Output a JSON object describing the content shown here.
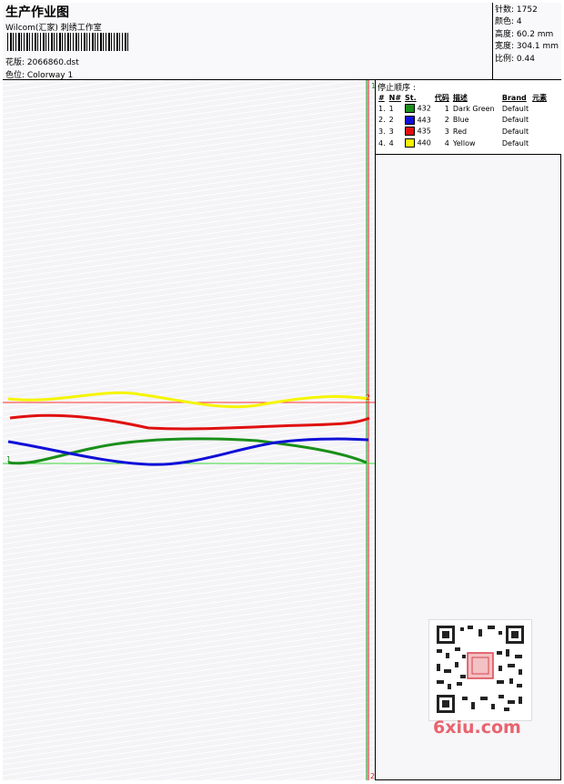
{
  "header": {
    "title": "生产作业图",
    "subtitle": "Wilcom(汇家) 刺绣工作室",
    "design_label": "花版: 2066860.dst",
    "colorway_label": "色位: Colorway 1"
  },
  "stats": {
    "stitches": "针数: 1752",
    "colors": "颜色: 4",
    "height": "高度: 60.2 mm",
    "width": "宽度: 304.1 mm",
    "scale": "比例: 0.44"
  },
  "stop_sequence": {
    "heading": "停止顺序 :",
    "columns": [
      "#",
      "N#",
      "St.",
      "代码",
      "描述",
      "Brand",
      "元素"
    ],
    "rows": [
      {
        "num": "1.",
        "n": "1",
        "st": "432",
        "code": "1",
        "desc": "Dark Green",
        "brand": "Default",
        "color": "#1a8f1a"
      },
      {
        "num": "2.",
        "n": "2",
        "st": "443",
        "code": "2",
        "desc": "Blue",
        "brand": "Default",
        "color": "#1010d8"
      },
      {
        "num": "3.",
        "n": "3",
        "st": "435",
        "code": "3",
        "desc": "Red",
        "brand": "Default",
        "color": "#e01010"
      },
      {
        "num": "4.",
        "n": "4",
        "st": "440",
        "code": "4",
        "desc": "Yellow",
        "brand": "Default",
        "color": "#f5f500"
      }
    ]
  },
  "markers": {
    "top_right": "1",
    "bottom_right": "2",
    "left_green": "1",
    "red_line_right": "2"
  },
  "watermark": "6xiu.com",
  "colors": {
    "green": "#1a8f1a",
    "blue": "#1010d8",
    "red": "#e01010",
    "yellow": "#f5f500",
    "guide_red": "#ff3030",
    "guide_green": "#38d838"
  }
}
